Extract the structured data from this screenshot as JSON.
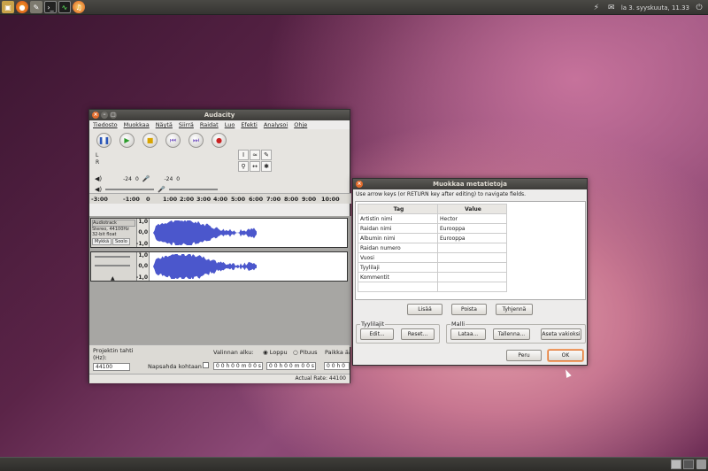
{
  "panel": {
    "clock": "la  3. syyskuuta, 11.33",
    "launchers": [
      "home-folder-icon",
      "firefox-icon",
      "gimp-icon",
      "terminal-icon",
      "system-monitor-icon",
      "audacity-icon"
    ]
  },
  "audacity": {
    "title": "Audacity",
    "menu": [
      "Tiedosto",
      "Muokkaa",
      "Näytä",
      "Siirrä",
      "Raidat",
      "Luo",
      "Efekti",
      "Analysoi",
      "Ohje"
    ],
    "meter_db": [
      "-24",
      "0",
      "-24",
      "0"
    ],
    "meter_left": [
      "L",
      "R"
    ],
    "ruler": [
      "-3:00",
      "-1:00",
      "0",
      "1:00",
      "2:00",
      "3:00",
      "4:00",
      "5:00",
      "6:00",
      "7:00",
      "8:00",
      "9:00",
      "10:00"
    ],
    "track": {
      "name": "Audiotrack",
      "info1": "Stereo, 44100Hz",
      "info2": "32-bit float",
      "mute": "Mykkä",
      "solo": "Soolo",
      "scale_top": [
        "1,0",
        "0,0",
        "-1,0"
      ],
      "scale_bottom": [
        "1,0",
        "0,0",
        "-1,0"
      ]
    },
    "selection": {
      "project_rate_label": "Projektin tahti (Hz):",
      "rate_value": "44100",
      "snap_label": "Napsahda kohtaan",
      "selection_start_label": "Valinnan alku:",
      "end_option": "Loppu",
      "length_option": "Pituus",
      "audio_position_label": "Paikka äänessä:",
      "time1": "0 0 h 0 0 m 0 0 s",
      "time2": "0 0 h 0 0 m 0 0 s",
      "time3": "0 0 h 0 0 m"
    },
    "status": "Actual Rate: 44100"
  },
  "metadata": {
    "title": "Muokkaa metatietoja",
    "hint": "Use arrow keys (or RETURN key after editing) to navigate fields.",
    "columns": [
      "Tag",
      "Value"
    ],
    "rows": [
      {
        "tag": "Artistin nimi",
        "value": "Hector"
      },
      {
        "tag": "Raidan nimi",
        "value": "Eurooppa"
      },
      {
        "tag": "Albumin nimi",
        "value": "Eurooppa"
      },
      {
        "tag": "Raidan numero",
        "value": ""
      },
      {
        "tag": "Vuosi",
        "value": ""
      },
      {
        "tag": "Tyylilaji",
        "value": ""
      },
      {
        "tag": "Kommentit",
        "value": ""
      },
      {
        "tag": "",
        "value": ""
      }
    ],
    "buttons": {
      "add": "Lisää",
      "remove": "Poista",
      "clear": "Tyhjennä",
      "genres_group": "Tyylilajit",
      "edit": "Edit...",
      "reset": "Reset...",
      "template_group": "Malli",
      "load": "Lataa...",
      "save": "Tallenna...",
      "set_default": "Aseta vakioksi",
      "cancel": "Peru",
      "ok": "OK"
    }
  }
}
